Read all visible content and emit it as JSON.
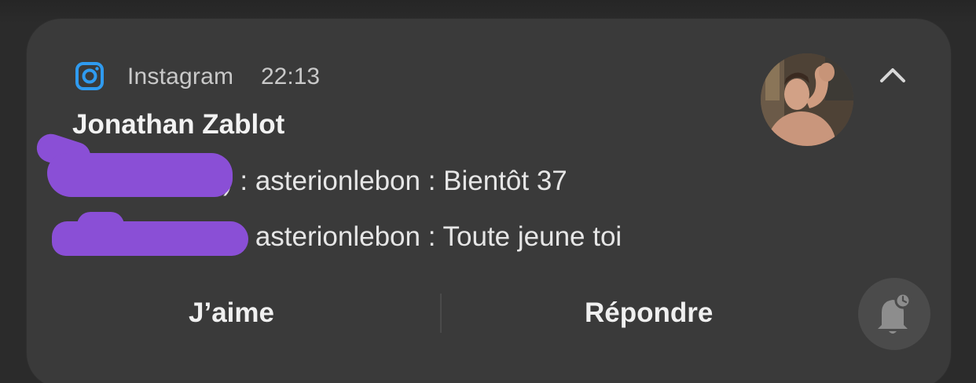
{
  "notification": {
    "app_name": "Instagram",
    "time": "22:13",
    "sender": "Jonathan Zablot",
    "messages": [
      {
        "text": ") : asterionlebon : Bientôt 37"
      },
      {
        "text": ") : asterionlebon : Toute jeune toi"
      }
    ],
    "redaction_color": "#8a4fd6",
    "icons": {
      "app": "instagram-icon",
      "collapse": "chevron-up-icon",
      "snooze": "bell-snooze-icon"
    }
  },
  "actions": {
    "like_label": "J’aime",
    "reply_label": "Répondre"
  },
  "colors": {
    "card_background": "#3a3a3a",
    "accent_instagram": "#2f9bf0"
  }
}
